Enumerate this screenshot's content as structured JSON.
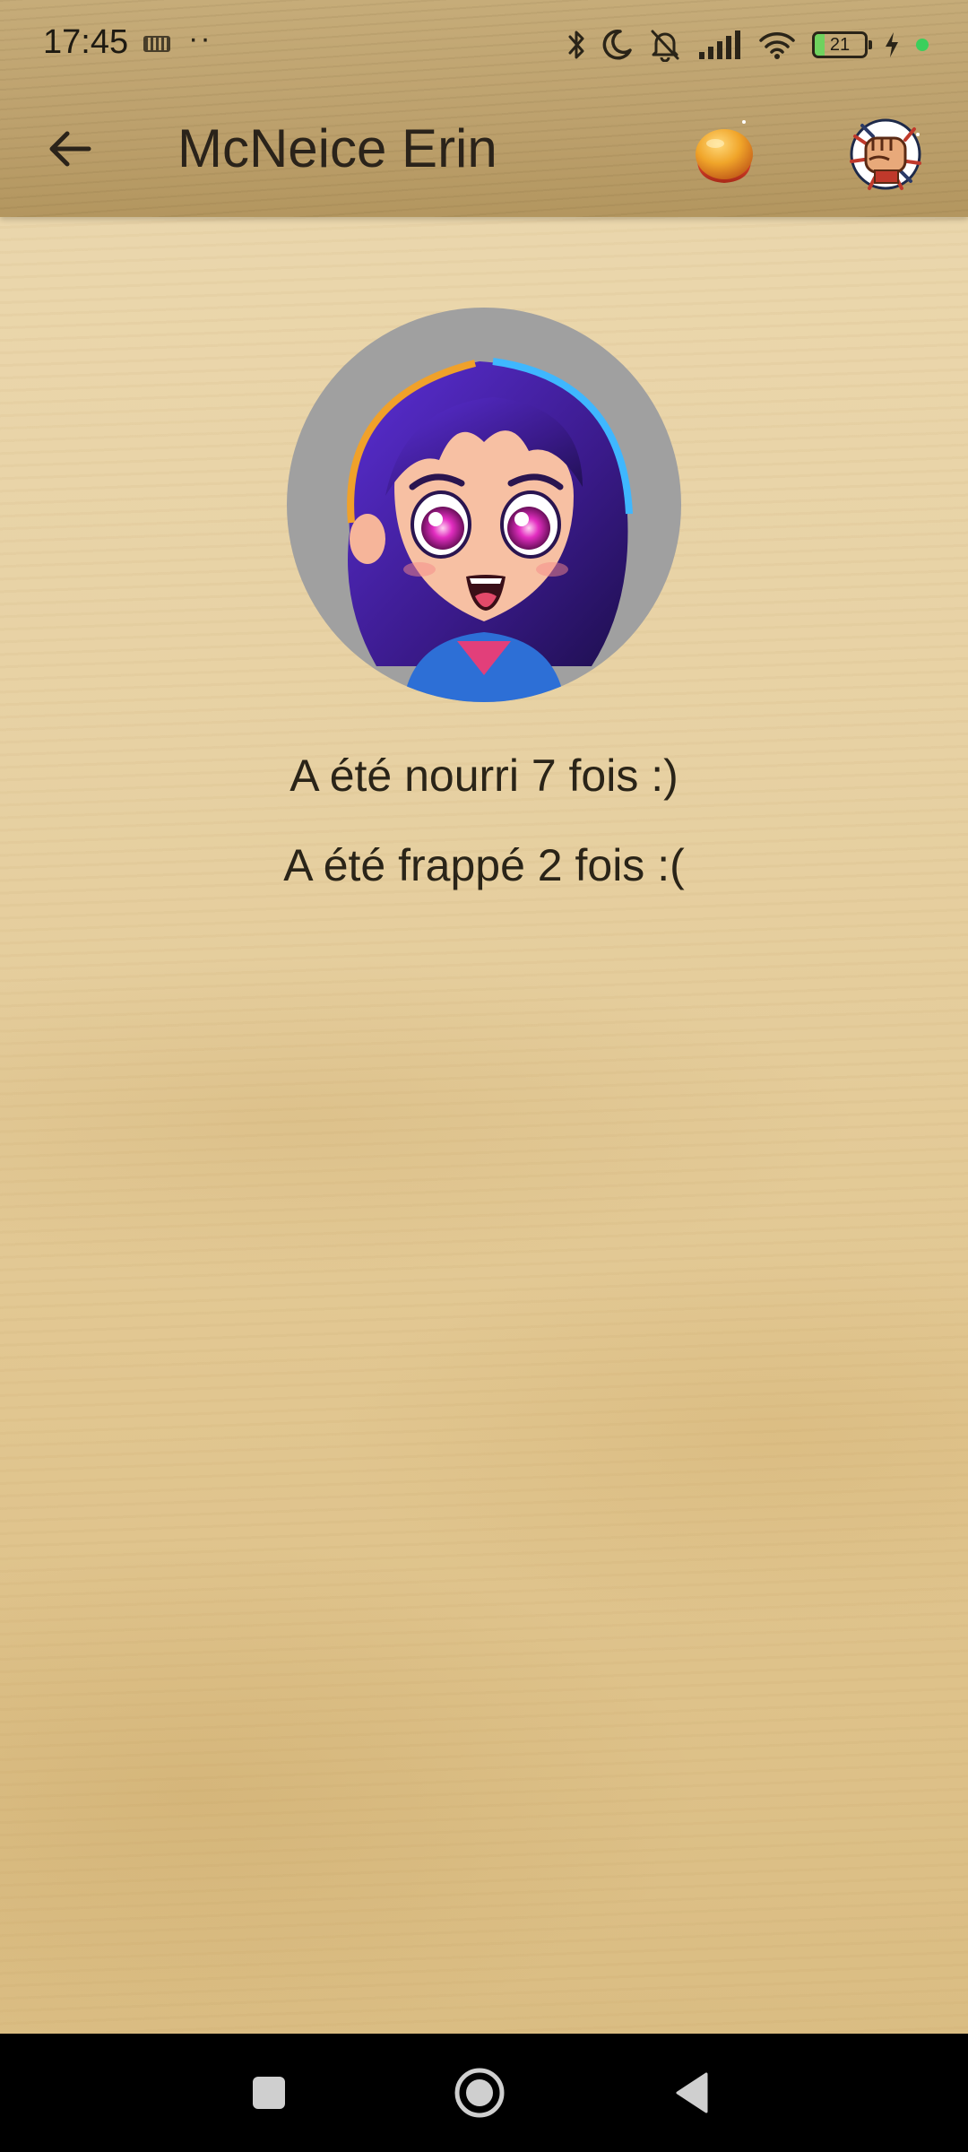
{
  "status_bar": {
    "time": "17:45",
    "dots": "··",
    "battery_level": "21",
    "icons": [
      "keyboard-icon",
      "bluetooth-icon",
      "moon-icon",
      "bell-off-icon",
      "signal-icon",
      "wifi-icon",
      "battery-icon",
      "charging-icon",
      "green-dot-icon"
    ]
  },
  "app_bar": {
    "title": "McNeice Erin",
    "back_icon": "arrow-left-icon",
    "feed_icon": "bread-icon",
    "punch_icon": "punch-fist-icon"
  },
  "profile": {
    "avatar": "anime-girl-avatar",
    "fed_text": "A été nourri 7 fois :)",
    "hit_text": "A été frappé 2 fois :("
  },
  "nav_bar": {
    "icons": [
      "square-recents-icon",
      "circle-home-icon",
      "triangle-back-icon"
    ]
  },
  "colors": {
    "wood_light": "#e7d1a3",
    "wood_header": "#bca06c",
    "nav_bar": "#000000",
    "avatar_bg": "#a0a0a0"
  }
}
